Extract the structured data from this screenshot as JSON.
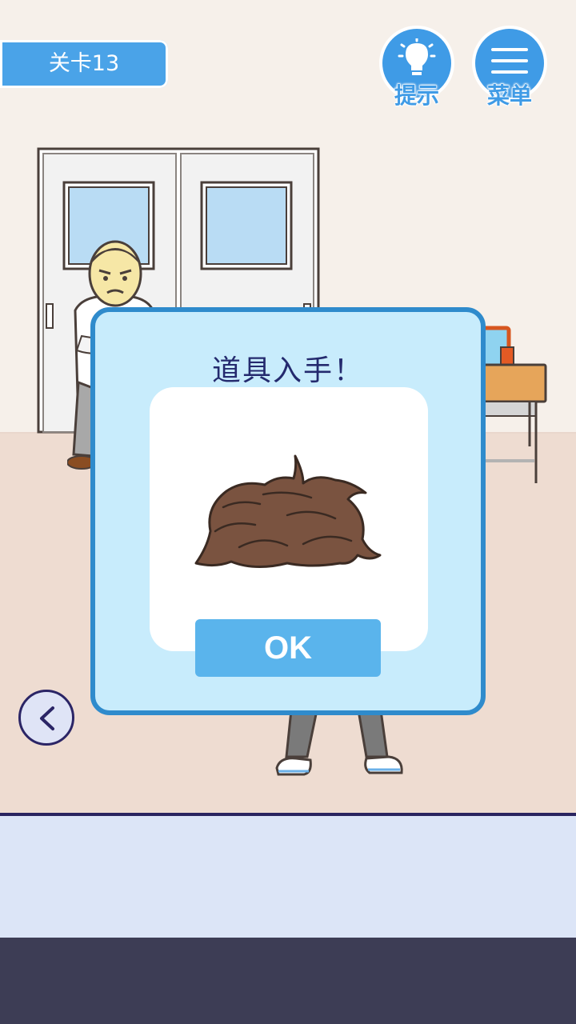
{
  "level": {
    "label": "关卡13"
  },
  "hint_button": {
    "label": "提示",
    "icon": "lightbulb-icon"
  },
  "menu_button": {
    "label": "菜单",
    "icon": "hamburger-menu-icon"
  },
  "back_button": {
    "icon": "chevron-left-icon"
  },
  "dialog": {
    "title": "道具入手！",
    "item": "wig-item",
    "ok_label": "OK"
  },
  "colors": {
    "accent_blue": "#3f9be6",
    "dialog_bg": "#c8ecfc",
    "dialog_border": "#2f8bcc",
    "title_text": "#242a6e",
    "ok_button": "#5ab4ec",
    "bottom_bar": "#3d3d55"
  }
}
